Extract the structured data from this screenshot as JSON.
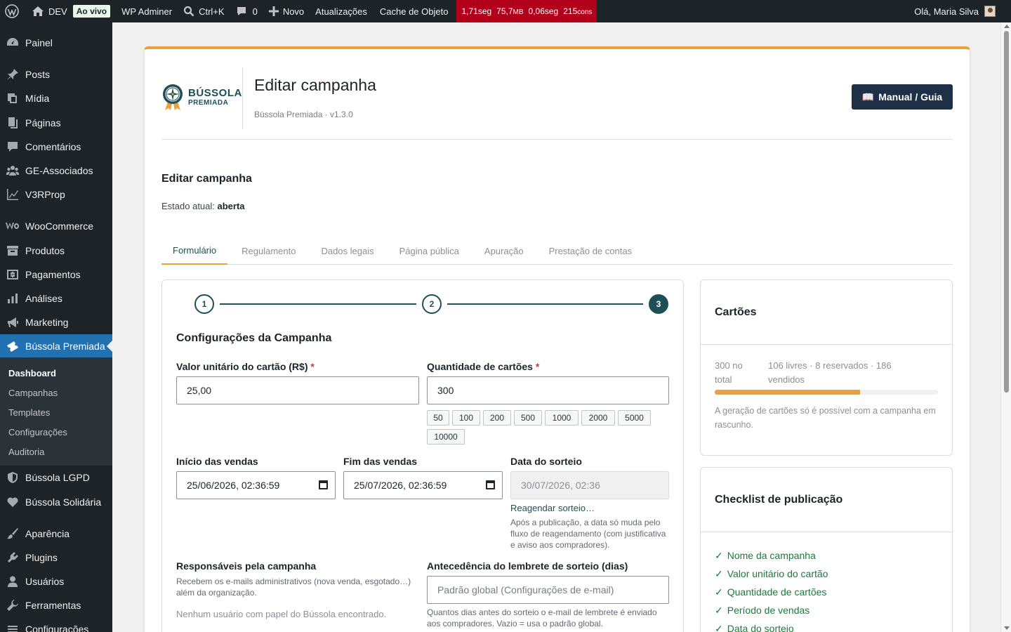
{
  "adminbar": {
    "site": "DEV",
    "live": "Ao vivo",
    "adminer": "WP Adminer",
    "search": "Ctrl+K",
    "comments_count": "0",
    "new": "Novo",
    "updates": "Atualizações",
    "cache": "Cache de Objeto",
    "qm": {
      "time": "1,71seg",
      "mem": "75,7",
      "mem_unit": "MB",
      "db_time": "0,06seg",
      "queries": "215",
      "queries_unit": "cons"
    },
    "howdy": "Olá, Maria Silva"
  },
  "sidebar": {
    "items": [
      {
        "label": "Painel",
        "icon": "dashboard-icon"
      },
      {
        "label": "Posts",
        "icon": "pin-icon"
      },
      {
        "label": "Mídia",
        "icon": "media-icon"
      },
      {
        "label": "Páginas",
        "icon": "pages-icon"
      },
      {
        "label": "Comentários",
        "icon": "comment-icon"
      },
      {
        "label": "GE-Associados",
        "icon": "groups-icon"
      },
      {
        "label": "V3RProp",
        "icon": "chart-line-icon"
      },
      {
        "label": "WooCommerce",
        "icon": "woo-icon"
      },
      {
        "label": "Produtos",
        "icon": "archive-icon"
      },
      {
        "label": "Pagamentos",
        "icon": "money-icon"
      },
      {
        "label": "Análises",
        "icon": "bar-chart-icon"
      },
      {
        "label": "Marketing",
        "icon": "megaphone-icon"
      },
      {
        "label": "Bússola Premiada",
        "icon": "tickets-icon"
      },
      {
        "label": "Bússola LGPD",
        "icon": "shield-icon"
      },
      {
        "label": "Bússola Solidária",
        "icon": "heart-icon"
      },
      {
        "label": "Aparência",
        "icon": "brush-icon"
      },
      {
        "label": "Plugins",
        "icon": "plugin-icon"
      },
      {
        "label": "Usuários",
        "icon": "user-icon"
      },
      {
        "label": "Ferramentas",
        "icon": "wrench-icon"
      },
      {
        "label": "Configurações",
        "icon": "settings-icon"
      }
    ],
    "submenu": [
      "Dashboard",
      "Campanhas",
      "Templates",
      "Configurações",
      "Auditoria"
    ]
  },
  "header": {
    "logo_line1": "BÚSSOLA",
    "logo_line2": "PREMIADA",
    "title": "Editar campanha",
    "subtitle": "Bússola Premiada · v1.3.0",
    "manual_button": "Manual / Guia"
  },
  "section": {
    "title": "Editar campanha",
    "state_label": "Estado atual:",
    "state_value": "aberta"
  },
  "tabs": [
    "Formulário",
    "Regulamento",
    "Dados legais",
    "Página pública",
    "Apuração",
    "Prestação de contas"
  ],
  "form": {
    "steps": [
      "1",
      "2",
      "3"
    ],
    "title": "Configurações da Campanha",
    "unit_value_label": "Valor unitário do cartão (R$)",
    "unit_value": "25,00",
    "quantity_label": "Quantidade de cartões",
    "quantity": "300",
    "quantity_presets": [
      "50",
      "100",
      "200",
      "500",
      "1000",
      "2000",
      "5000",
      "10000"
    ],
    "required_mark": "*",
    "sales_start_label": "Início das vendas",
    "sales_start": "25/06/2026, 02:36:59",
    "sales_end_label": "Fim das vendas",
    "sales_end": "25/07/2026, 02:36:59",
    "draw_date_label": "Data do sorteio",
    "draw_date": "30/07/2026, 02:36",
    "reschedule_link": "Reagendar sorteio…",
    "draw_help": "Após a publicação, a data só muda pelo fluxo de reagendamento (com justificativa e aviso aos compradores).",
    "responsibles_label": "Responsáveis pela campanha",
    "responsibles_help": "Recebem os e-mails administrativos (nova venda, esgotado…) além da organização.",
    "responsibles_empty": "Nenhum usuário com papel do Bússola encontrado.",
    "reminder_label": "Antecedência do lembrete de sorteio (dias)",
    "reminder_placeholder": "Padrão global (Configurações de e-mail)",
    "reminder_help": "Quantos dias antes do sorteio o e-mail de lembrete é enviado aos compradores. Vazio = usa o padrão global."
  },
  "cards_panel": {
    "title": "Cartões",
    "total_line1": "300 no",
    "total_line2": "total",
    "breakdown_line1": "106 livres · 8 reservados · 186",
    "breakdown_line2": "vendidos",
    "progress_fraction": 0.65,
    "note": "A geração de cartões só é possível com a campanha em rascunho."
  },
  "checklist": {
    "title": "Checklist de publicação",
    "mark": "✓",
    "items": [
      "Nome da campanha",
      "Valor unitário do cartão",
      "Quantidade de cartões",
      "Período de vendas",
      "Data do sorteio"
    ]
  },
  "colors": {
    "accent": "#e9a23b",
    "brand": "#1f4f56",
    "wp_blue": "#2271b1",
    "success": "#1a7a3c"
  }
}
